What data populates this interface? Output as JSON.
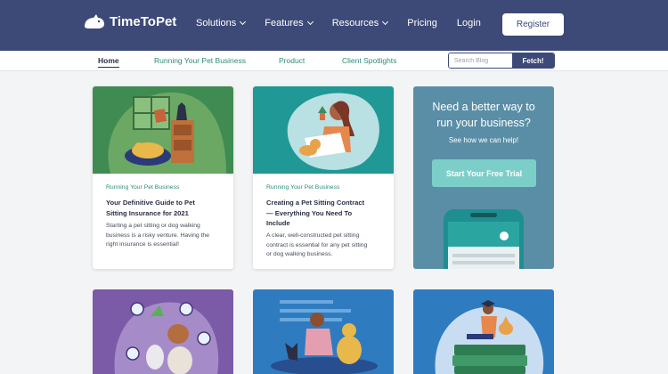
{
  "header": {
    "brand": "TimeToPet",
    "nav": [
      {
        "label": "Solutions",
        "dropdown": true
      },
      {
        "label": "Features",
        "dropdown": true
      },
      {
        "label": "Resources",
        "dropdown": true
      },
      {
        "label": "Pricing",
        "dropdown": false
      },
      {
        "label": "Login",
        "dropdown": false
      }
    ],
    "register": "Register"
  },
  "subnav": {
    "items": [
      "Home",
      "Running Your Pet Business",
      "Product",
      "Client Spotlights"
    ],
    "search_placeholder": "Search Blog",
    "fetch": "Fetch!"
  },
  "cards": [
    {
      "category": "Running Your Pet Business",
      "title_lines": [
        "Your Definitive Guide to Pet",
        "Sitting Insurance for 2021"
      ],
      "desc_lines": [
        "Starting a pet sitting or dog walking",
        "business is a risky venture. Having the",
        "right insurance is essential!"
      ]
    },
    {
      "category": "Running Your Pet Business",
      "title_lines": [
        "Creating a Pet Sitting Contract",
        "— Everything You Need To",
        "Include"
      ],
      "desc_lines": [
        "A clear, well-constructed pet sitting",
        "contract is essential for any pet sitting",
        "or dog walking business."
      ]
    }
  ],
  "promo": {
    "heading_lines": [
      "Need a better way to",
      "run your business?"
    ],
    "sub": "See how we can help!",
    "button": "Start Your Free Trial"
  },
  "colors": {
    "primary": "#3d4977",
    "accent": "#2f8a78",
    "promo": "#5a8ea6",
    "cta_button": "#7ccfc9"
  }
}
